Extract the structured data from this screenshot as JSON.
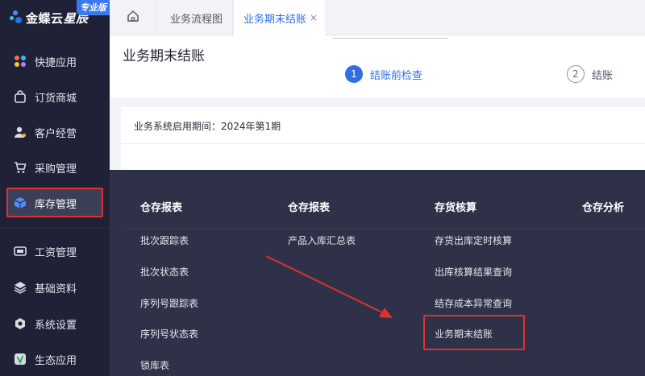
{
  "app": {
    "logo_text": "金蝶云",
    "logo_sub": "星辰",
    "edition_badge": "专业版"
  },
  "sidebar": {
    "items": [
      {
        "label": "快捷应用",
        "icon": "apps-grid-icon"
      },
      {
        "label": "订货商城",
        "icon": "shopping-bag-icon"
      },
      {
        "label": "客户经营",
        "icon": "customer-icon"
      },
      {
        "label": "采购管理",
        "icon": "cart-icon"
      },
      {
        "label": "库存管理",
        "icon": "inventory-box-icon",
        "active": true
      },
      {
        "label": "工资管理",
        "icon": "payroll-icon"
      },
      {
        "label": "基础资料",
        "icon": "layers-icon"
      },
      {
        "label": "系统设置",
        "icon": "settings-icon"
      },
      {
        "label": "生态应用",
        "icon": "ecosystem-icon"
      }
    ]
  },
  "tabs": {
    "home_icon": "home-icon",
    "items": [
      {
        "label": "业务流程图",
        "active": false
      },
      {
        "label": "业务期末结账",
        "active": true,
        "close": "×"
      }
    ]
  },
  "page": {
    "title": "业务期末结账",
    "steps": [
      {
        "number": "1",
        "label": "结账前检查",
        "active": true
      },
      {
        "number": "2",
        "label": "结账",
        "active": false
      }
    ],
    "info_text": "业务系统启用期间：2024年第1期"
  },
  "dropdown": {
    "columns": [
      {
        "header": "仓存报表",
        "items": [
          "批次跟踪表",
          "批次状态表",
          "序列号跟踪表",
          "序列号状态表",
          "锁库表"
        ]
      },
      {
        "header": "仓存报表",
        "items": [
          "产品入库汇总表"
        ]
      },
      {
        "header": "存货核算",
        "items": [
          "存货出库定时核算",
          "出库核算结果查询",
          "结存成本异常查询",
          "业务期末结账"
        ]
      },
      {
        "header": "仓存分析",
        "items": []
      }
    ],
    "highlighted_item": "业务期末结账"
  },
  "colors": {
    "sidebar_bg": "#1f2236",
    "dropdown_bg": "#2e3147",
    "accent_blue": "#2f6fe4",
    "annotation_red": "#e03131"
  }
}
